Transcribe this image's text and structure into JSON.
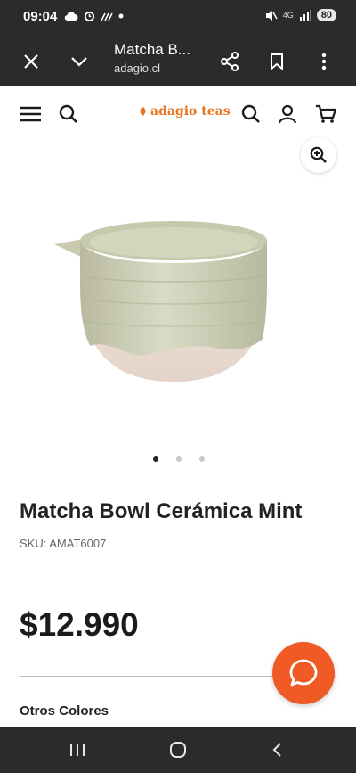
{
  "status_bar": {
    "time": "09:04",
    "left_icons": [
      "cloud-icon",
      "alarm-icon",
      "signal-strike-icon",
      "dot-icon"
    ],
    "network_label": "4G",
    "battery": "80"
  },
  "browser": {
    "title": "Matcha B...",
    "domain": "adagio.cl"
  },
  "site": {
    "logo_text": "adagio teas",
    "brand_color": "#e8721e"
  },
  "product": {
    "image_count": 3,
    "active_image": 1,
    "title": "Matcha Bowl Cerámica Mint",
    "sku": "SKU: AMAT6007",
    "price": "$12.990"
  },
  "section": {
    "other_colors": "Otros Colores"
  },
  "colors": {
    "chat_button": "#f05a24",
    "system_bar": "#2b2b2b"
  }
}
